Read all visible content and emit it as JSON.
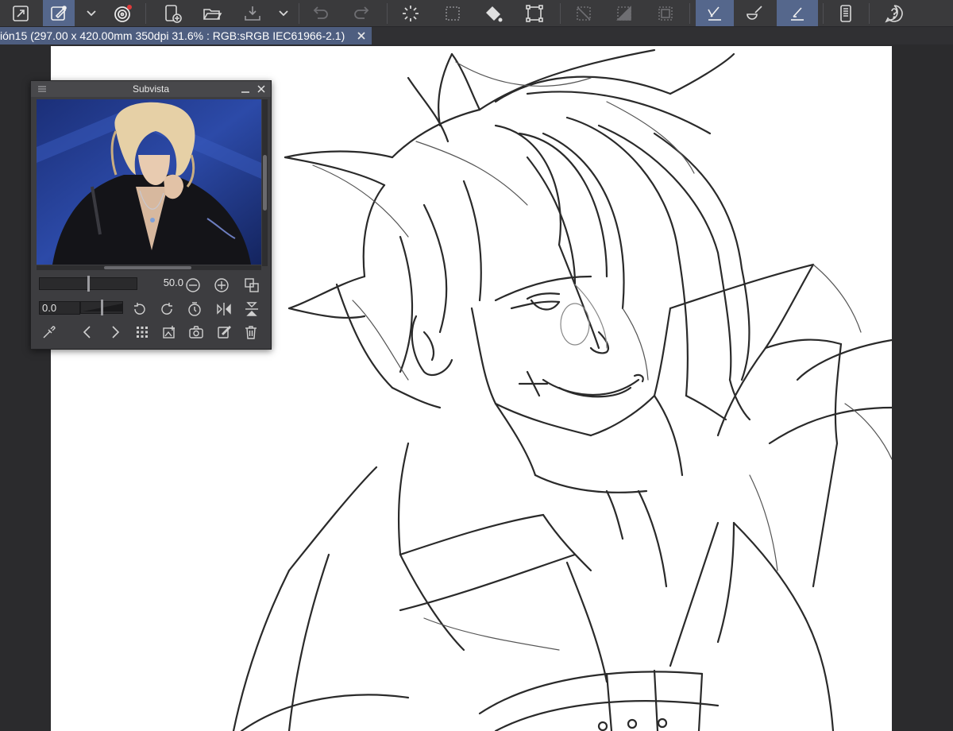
{
  "document_tab": {
    "title": "ión15 (297.00 x 420.00mm 350dpi 31.6% : RGB:sRGB IEC61966-2.1)"
  },
  "toolbar": {
    "buttons": [
      {
        "name": "expand-canvas-icon"
      },
      {
        "name": "brush-tool-icon",
        "active": true
      },
      {
        "name": "chevron-down-icon"
      },
      {
        "name": "spiral-app-icon"
      },
      {
        "name": "new-page-icon"
      },
      {
        "name": "open-folder-icon"
      },
      {
        "name": "save-download-icon"
      },
      {
        "name": "chevron-down-icon"
      },
      {
        "name": "undo-icon"
      },
      {
        "name": "redo-icon"
      },
      {
        "name": "loading-spinner-icon"
      },
      {
        "name": "selection-dotted-icon"
      },
      {
        "name": "fill-bucket-icon"
      },
      {
        "name": "transform-icon"
      },
      {
        "name": "clear-selection-icon"
      },
      {
        "name": "invert-selection-icon"
      },
      {
        "name": "select-border-icon"
      },
      {
        "name": "ruler-pen-icon",
        "active": true
      },
      {
        "name": "brush-blend-icon"
      },
      {
        "name": "ruler-snap-icon",
        "active": true
      },
      {
        "name": "mobile-companion-icon"
      },
      {
        "name": "help-icon"
      }
    ]
  },
  "subview": {
    "title": "Subvista",
    "zoom_value": "50.0",
    "rotation_value": "0.0",
    "zoom_level": 0.5,
    "rotation_level": 0.5
  },
  "colors": {
    "toolbar_bg": "#3a3a3c",
    "active_button": "#55678c",
    "tab_bg": "#4e5e80",
    "canvas_bg": "#ffffff",
    "panel_bg": "#3d3d40"
  }
}
